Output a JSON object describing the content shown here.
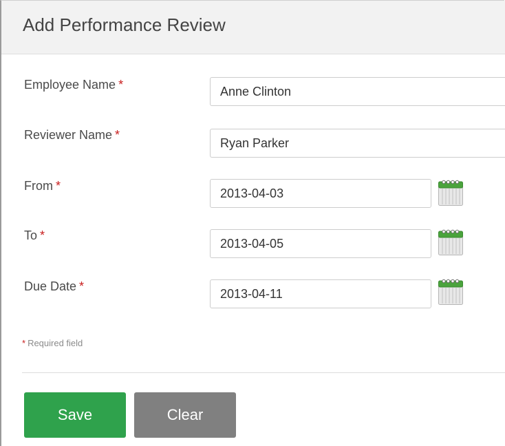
{
  "form": {
    "title": "Add Performance Review",
    "required_marker": "*",
    "fields": {
      "employee_name": {
        "label": "Employee Name",
        "value": "Anne Clinton"
      },
      "reviewer_name": {
        "label": "Reviewer Name",
        "value": "Ryan Parker"
      },
      "from": {
        "label": "From",
        "value": "2013-04-03"
      },
      "to": {
        "label": "To",
        "value": "2013-04-05"
      },
      "due_date": {
        "label": "Due Date",
        "value": "2013-04-11"
      }
    },
    "required_hint": "Required field",
    "buttons": {
      "save": "Save",
      "clear": "Clear"
    }
  },
  "icons": {
    "calendar": "calendar-icon"
  },
  "colors": {
    "required": "#c81e1e",
    "save_button": "#2fa24c",
    "clear_button": "#808080",
    "header_bg": "#f2f2f2",
    "calendar_green": "#4aa33c"
  }
}
